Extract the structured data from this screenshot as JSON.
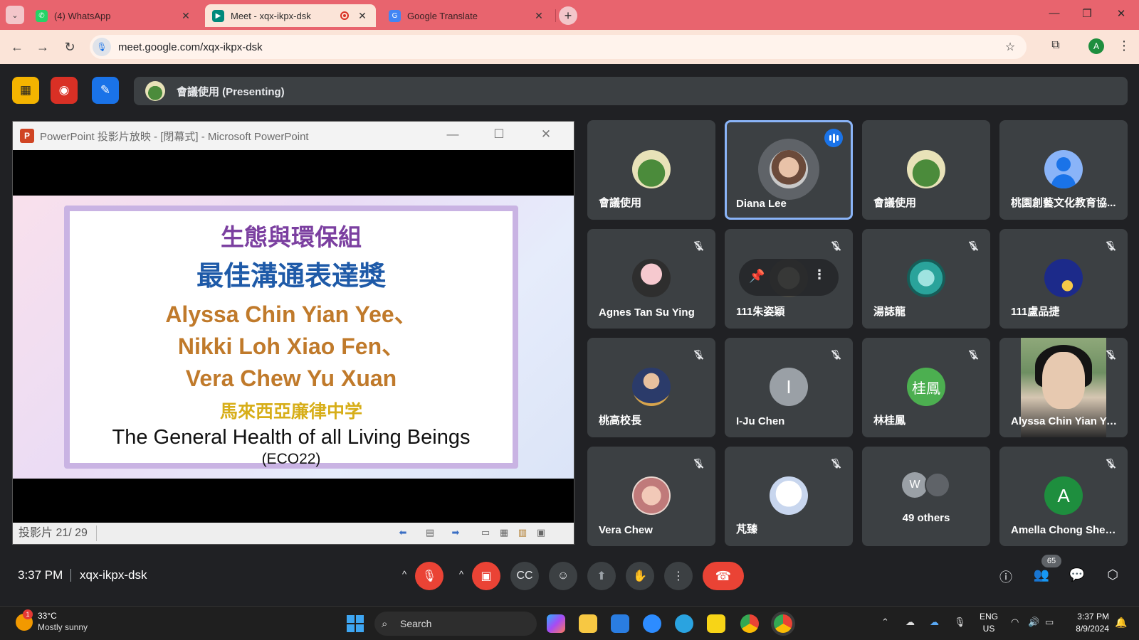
{
  "browser": {
    "tabs": [
      {
        "title": "(4) WhatsApp",
        "icon": "whatsapp-icon"
      },
      {
        "title": "Meet - xqx-ikpx-dsk",
        "icon": "google-meet-icon",
        "recording": true
      },
      {
        "title": "Google Translate",
        "icon": "google-translate-icon"
      }
    ],
    "url": "meet.google.com/xqx-ikpx-dsk",
    "profile_initial": "A"
  },
  "meet": {
    "presenting_label": "會議使用 (Presenting)",
    "presentation": {
      "window_title": "PowerPoint 投影片放映 - [閉幕式] - Microsoft PowerPoint",
      "app_letter": "P",
      "slide": {
        "line1": "生態與環保組",
        "line2": "最佳溝通表達獎",
        "names": [
          "Alyssa Chin Yian Yee、",
          "Nikki Loh Xiao Fen、",
          "Vera Chew Yu Xuan"
        ],
        "school": "馬來西亞廉律中学",
        "project": "The General Health of all Living Beings",
        "code": "(ECO22)"
      },
      "status": "投影片 21/ 29"
    },
    "participants": [
      {
        "name": "會議使用",
        "avatar": "tree"
      },
      {
        "name": "Diana Lee",
        "avatar": "photo",
        "speaking": true
      },
      {
        "name": "會議使用",
        "avatar": "tree"
      },
      {
        "name": "桃園創藝文化教育協...",
        "avatar": "default-person"
      },
      {
        "name": "Agnes Tan Su Ying",
        "muted": true,
        "avatar": "silhouette"
      },
      {
        "name": "111朱姿穎",
        "muted": true,
        "avatar": "photo",
        "pinned_overlay": true
      },
      {
        "name": "湯誌龍",
        "muted": true,
        "avatar": "rose"
      },
      {
        "name": "111盧品捷",
        "muted": true,
        "avatar": "night"
      },
      {
        "name": "桃高校長",
        "muted": true,
        "avatar": "photo"
      },
      {
        "name": "I-Ju Chen",
        "muted": true,
        "initial": "I",
        "color": "#9aa0a6"
      },
      {
        "name": "林桂鳳",
        "muted": true,
        "initial": "桂鳳",
        "color": "#4caf50"
      },
      {
        "name": "Alyssa Chin Yian Ye...",
        "muted": true,
        "video": true
      },
      {
        "name": "Vera Chew",
        "muted": true,
        "avatar": "art"
      },
      {
        "name": "芃臻",
        "muted": true,
        "avatar": "cartoon"
      },
      {
        "others": "49 others",
        "initial": "W"
      },
      {
        "name": "Amella Chong Shen...",
        "muted": true,
        "initial": "A",
        "color": "#1e8e3e"
      }
    ],
    "time": "3:37 PM",
    "code": "xqx-ikpx-dsk",
    "participant_count": "65"
  },
  "taskbar": {
    "temperature": "33°C",
    "weather": "Mostly sunny",
    "weather_badge": "1",
    "search_label": "Search",
    "lang": "ENG",
    "region": "US",
    "time": "3:37 PM",
    "date": "8/9/2024"
  },
  "colors": {
    "tab_strip": "#e8646e",
    "toolbar": "#fbe4d8",
    "meet_bg": "#202124",
    "tile_bg": "#3c4043",
    "danger": "#ea4335",
    "accent": "#1a73e8"
  }
}
